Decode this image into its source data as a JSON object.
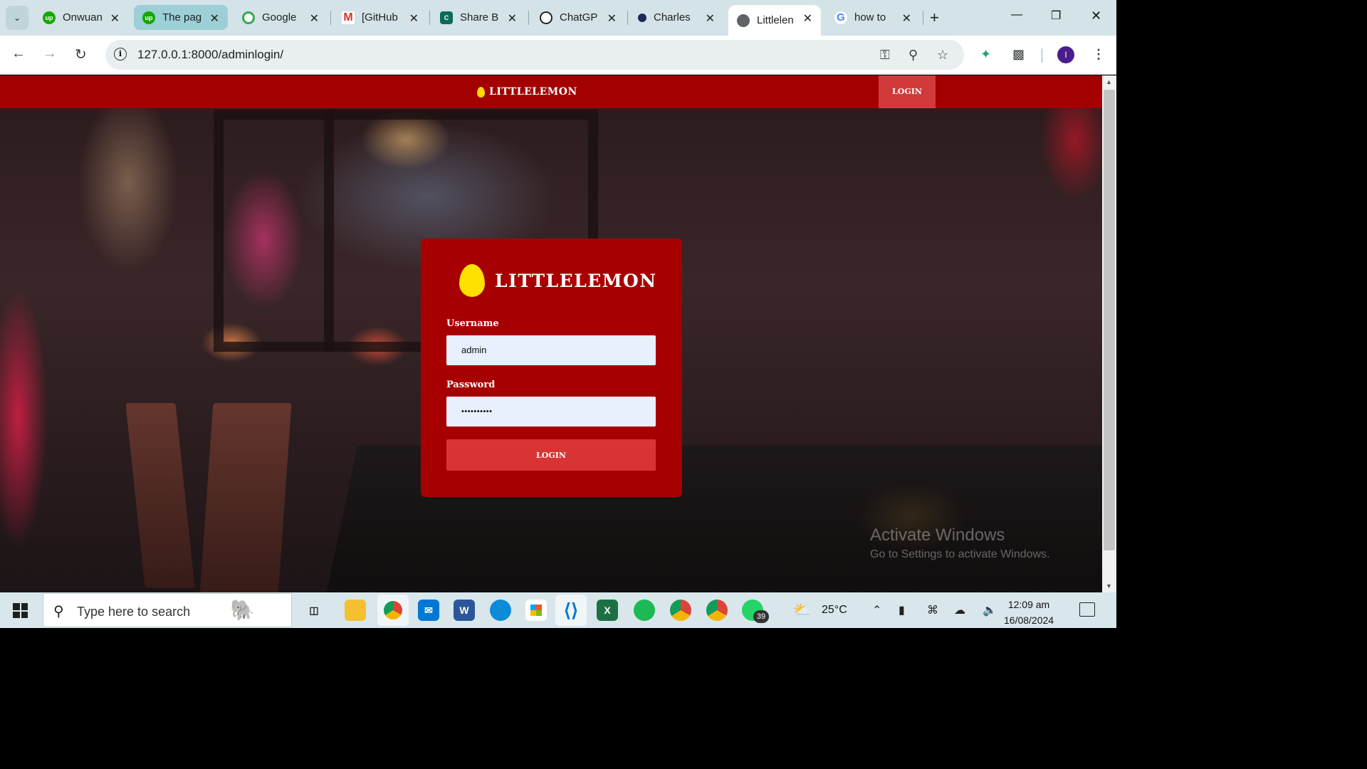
{
  "browser": {
    "tabs": [
      {
        "title": "Onwuan",
        "favicon": "upwork-icon",
        "color": "#14a800"
      },
      {
        "title": "The pag",
        "favicon": "upwork-icon",
        "color": "#14a800"
      },
      {
        "title": "Google",
        "favicon": "google-meet-icon",
        "color": "#ffffff"
      },
      {
        "title": "[GitHub",
        "favicon": "gmail-icon",
        "color": "#ffffff"
      },
      {
        "title": "Share B",
        "favicon": "share-icon",
        "color": "#0a6b57"
      },
      {
        "title": "ChatGP",
        "favicon": "chatgpt-icon",
        "color": "#ffffff"
      },
      {
        "title": "Charles",
        "favicon": "charles-icon",
        "color": "#1e2a5a"
      },
      {
        "title": "Littlelen",
        "favicon": "globe-icon",
        "color": "#5f6368"
      },
      {
        "title": "how to",
        "favicon": "google-icon",
        "color": "#ffffff"
      }
    ],
    "url": "127.0.0.1:8000/adminlogin/",
    "profile_initial": "I"
  },
  "site": {
    "brand": "LITTLELEMON",
    "nav_login": "LOGIN"
  },
  "login_form": {
    "brand": "LITTLELEMON",
    "username_label": "Username",
    "username_value": "admin",
    "password_label": "Password",
    "password_value": "••••••••••",
    "submit_label": "LOGIN"
  },
  "watermark": {
    "line1": "Activate Windows",
    "line2": "Go to Settings to activate Windows."
  },
  "taskbar": {
    "search_placeholder": "Type here to search",
    "whatsapp_badge": "39",
    "temperature": "25°C",
    "time": "12:09 am",
    "date": "16/08/2024"
  },
  "colors": {
    "nav_red": "#a30000",
    "card_red": "#a70000",
    "button_red": "#d93434",
    "lemon_yellow": "#ffe100"
  }
}
